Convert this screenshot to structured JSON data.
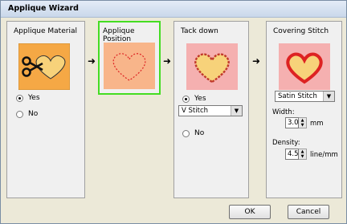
{
  "window": {
    "title": "Applique Wizard"
  },
  "steps": [
    {
      "title": "Applique Material",
      "icon": "scissors-heart-icon"
    },
    {
      "title": "Applique Position",
      "icon": "dotted-heart-icon"
    },
    {
      "title": "Tack down",
      "icon": "wavy-heart-icon"
    },
    {
      "title": "Covering Stitch",
      "icon": "satin-heart-icon"
    }
  ],
  "material": {
    "yes": "Yes",
    "no": "No",
    "selected": "Yes"
  },
  "tackdown": {
    "yes": "Yes",
    "no": "No",
    "selected": "Yes",
    "stitch": "V Stitch"
  },
  "covering": {
    "stitch": "Satin Stitch",
    "width_label": "Width:",
    "width_value": "3.0",
    "width_unit": "mm",
    "density_label": "Density:",
    "density_value": "4.5",
    "density_unit": "line/mm"
  },
  "buttons": {
    "ok": "OK",
    "cancel": "Cancel"
  },
  "colors": {
    "highlight": "#44dd22",
    "heart": "#dd2222",
    "art_orange": "#f5a845",
    "art_peach": "#f8b58a",
    "art_pink": "#f5b0b0"
  }
}
